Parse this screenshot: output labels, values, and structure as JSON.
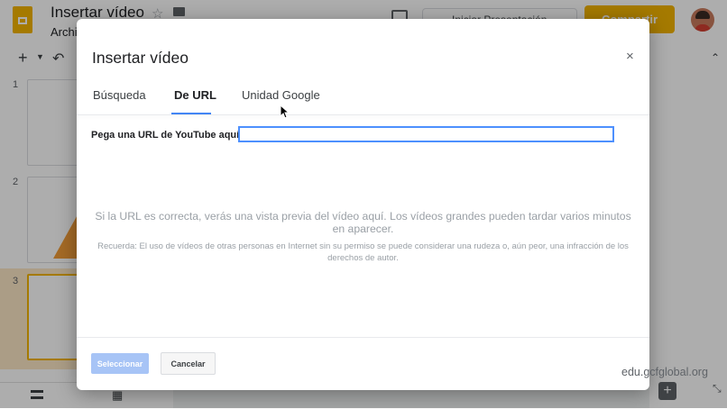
{
  "app": {
    "doc_title": "Insertar vídeo",
    "menu_first": "Archi",
    "present_label": "Iniciar Presentación",
    "share_label": "Compartir"
  },
  "filmstrip": {
    "slides": [
      {
        "number": "1"
      },
      {
        "number": "2"
      },
      {
        "number": "3"
      }
    ]
  },
  "dialog": {
    "title": "Insertar vídeo",
    "close_label": "×",
    "tabs": [
      {
        "label": "Búsqueda"
      },
      {
        "label": "De URL",
        "active": true
      },
      {
        "label": "Unidad Google"
      }
    ],
    "url_label": "Pega una URL de YouTube aquí:",
    "url_value": "",
    "preview_message": "Si la URL es correcta, verás una vista previa del vídeo aquí. Los vídeos grandes pueden tardar varios minutos en aparecer.",
    "legal_message": "Recuerda: El uso de vídeos de otras personas en Internet sin su permiso se puede considerar una rudeza o, aún peor, una infracción de los derechos de autor.",
    "select_label": "Seleccionar",
    "cancel_label": "Cancelar"
  },
  "watermark": "edu.gcfglobal.org",
  "colors": {
    "accent": "#4285f4",
    "brand_yellow": "#f4b400",
    "select_disabled": "#a7c4f6"
  },
  "icons": [
    "slides-doc-icon",
    "star-icon",
    "folder-icon",
    "present-icon",
    "close-icon",
    "plus-icon",
    "undo-icon",
    "grid-view-icon",
    "list-view-icon",
    "add-comment-icon",
    "cursor-icon"
  ]
}
